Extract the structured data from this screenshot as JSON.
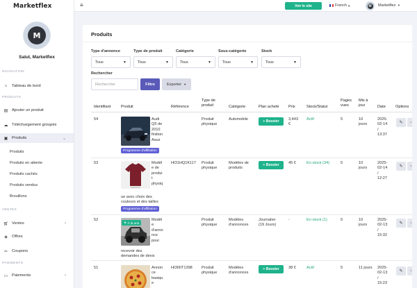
{
  "brand": "Marketflex",
  "avatar_initial": "M",
  "greeting": "Salut, Marketflex",
  "sections": {
    "navigation": "NAVIGATION",
    "produits": "PRODUITS",
    "ventes": "VENTES",
    "paiements": "PAIEMENTS"
  },
  "nav": {
    "dashboard": "Tableau de bord",
    "add_product": "Ajouter un produit",
    "bulk_upload": "Téléchargement groupés",
    "products": "Produits",
    "sales": "Ventes",
    "offers": "Offres",
    "coupons": "Coupons",
    "payments": "Paiements"
  },
  "subnav": {
    "all": "Produits",
    "pending": "Produits en attente",
    "hidden": "Produits cachés",
    "sold": "Produits vendus",
    "drafts": "Brouillons"
  },
  "topbar": {
    "visit_site": "Voir le site",
    "language": "French",
    "user_name": "Marketflex",
    "user_initial": "M"
  },
  "page": {
    "title": "Produits"
  },
  "filters": {
    "type_annonce": {
      "label": "Type d'annonce",
      "value": "Tous"
    },
    "type_produit": {
      "label": "Type de produit",
      "value": "Tous"
    },
    "categorie": {
      "label": "Catégorie",
      "value": "Tous"
    },
    "sous_categorie": {
      "label": "Sous-catégorie",
      "value": "Tous"
    },
    "stock": {
      "label": "Stock",
      "value": "Tous"
    },
    "search_label": "Rechercher",
    "search_placeholder": "Rechercher",
    "filter_btn": "Filtre",
    "export_btn": "Exporter"
  },
  "table": {
    "headers": {
      "id": "Identifiant",
      "product": "Produit",
      "reference": "Référence",
      "type_l1": "Type de",
      "type_l2": "produit",
      "category": "Catégorie",
      "plan": "Plan acheté",
      "price": "Prix",
      "stock": "Stock/Statut",
      "pages_l1": "Pages",
      "pages_l2": "vues",
      "updated_l1": "Mis à",
      "updated_l2": "jour",
      "date": "Date",
      "options": "Options"
    },
    "rows": [
      {
        "id": "54",
        "name_lines": [
          "Audi",
          "Q5 de",
          "2010",
          "finition",
          "Asus"
        ],
        "pill": "Programme d'affiliation",
        "reference": "",
        "type_lines": [
          "Produit",
          "physique"
        ],
        "category_lines": [
          "Automobile"
        ],
        "boost": "Booster",
        "price_lines": [
          "3,443",
          "€"
        ],
        "stock": "Actif",
        "pages": "5",
        "updated_lines": [
          "10",
          "jours"
        ],
        "date_lines": [
          "2025-",
          "02-14",
          "/",
          "13:37"
        ]
      },
      {
        "id": "53",
        "name_lines": [
          "Modèl",
          "e de",
          "produi",
          "t",
          "physiq",
          "ue avec choix des",
          "couleurs et des tailles"
        ],
        "pill": "Programme d'affiliation",
        "reference": "HI31HQ1K117",
        "type_lines": [
          "Produit",
          "physique"
        ],
        "category_lines": [
          "Modèles de",
          "produits"
        ],
        "boost": "Booster",
        "price_lines": [
          "45 €"
        ],
        "stock": "En stock (34)",
        "pages": "5",
        "updated_lines": [
          "10",
          "jours"
        ],
        "date_lines": [
          "2025-",
          "02-14",
          "/",
          "12:27"
        ]
      },
      {
        "id": "52",
        "badge": "À la une",
        "name_lines": [
          "Modèl",
          "e",
          "d'anno",
          "nce",
          "pour",
          "recevoir des",
          "demandes de devis"
        ],
        "reference": "",
        "type_lines": [
          "Produit",
          "physique"
        ],
        "category_lines": [
          "Modèles",
          "d'annonces"
        ],
        "plan_lines": [
          "Journalier",
          "(19 Jours)"
        ],
        "price_lines": [
          "-"
        ],
        "stock": "En stock (1)",
        "pages": "5",
        "updated_lines": [
          "10",
          "jours"
        ],
        "date_lines": [
          "2025-",
          "02-13",
          "/",
          "15:32"
        ]
      },
      {
        "id": "51",
        "name_lines": [
          "Annon",
          "ce",
          "basiqu",
          "e"
        ],
        "reference": "HI3I9IT1398",
        "type_lines": [
          "Produit",
          "physique"
        ],
        "category_lines": [
          "Modèles",
          "d'annonces"
        ],
        "boost": "Booster",
        "price_lines": [
          "38 €"
        ],
        "stock": "Actif",
        "pages": "5",
        "updated_lines": [
          "11 jours"
        ],
        "date_lines": [
          "2025-",
          "02-13",
          "/",
          "15:23"
        ]
      }
    ]
  }
}
